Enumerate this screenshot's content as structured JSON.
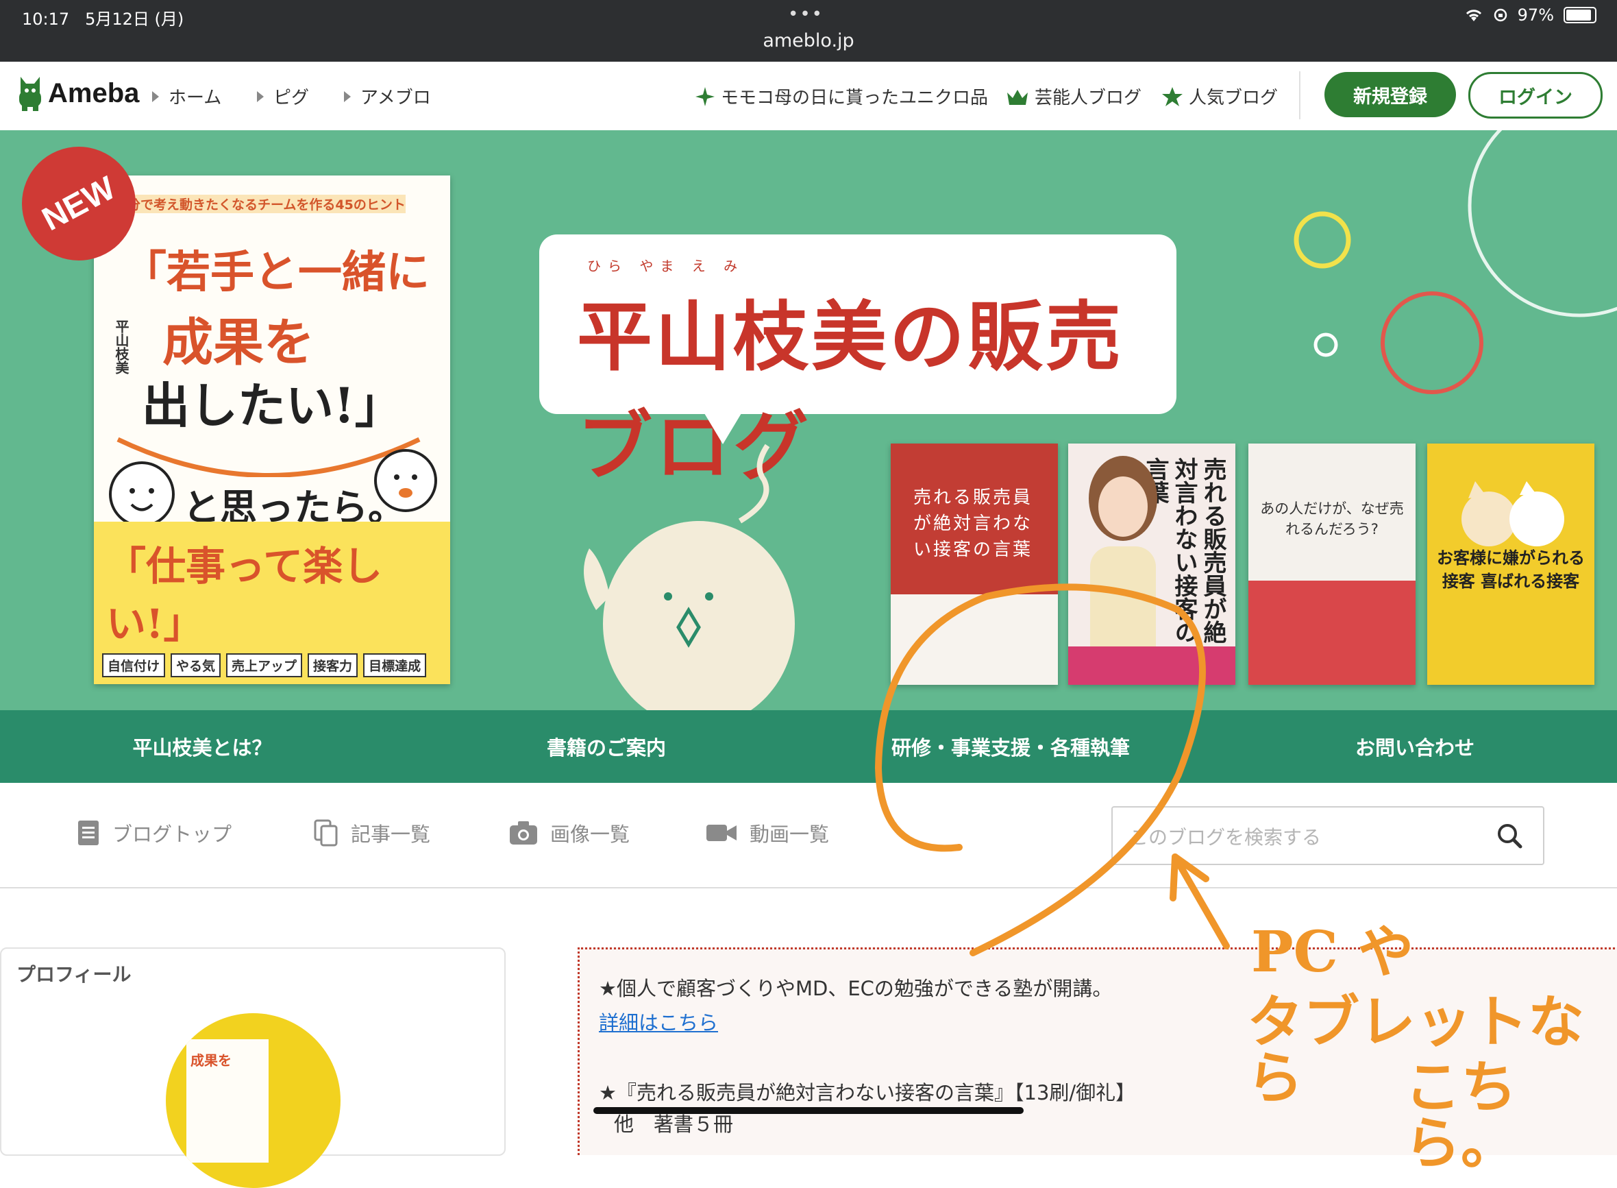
{
  "status_bar": {
    "time": "10:17",
    "date": "5月12日 (月)",
    "url": "ameblo.jp",
    "battery": "97%"
  },
  "nav": {
    "logo": "Ameba",
    "links": [
      "ホーム",
      "ピグ",
      "アメブロ"
    ],
    "right_links": [
      "モモコ母の日に貰ったユニクロ品",
      "芸能人ブログ",
      "人気ブログ"
    ],
    "register": "新規登録",
    "login": "ログイン"
  },
  "banner": {
    "badge": "NEW",
    "ruby": "ひら やま え み",
    "title": "平山枝美の販売ブログ",
    "book_main": {
      "top_line": "自分で考え動きたくなるチームを作る45のヒント",
      "title_1": "「若手と一緒に",
      "title_2": "成果を",
      "title_3": "出したい!」",
      "subtitle": "と思ったら。",
      "author": "平山枝美",
      "tagline": "「仕事って楽しい!」",
      "tags": [
        "自信付け",
        "やる気",
        "売上アップ",
        "接客力",
        "目標達成"
      ]
    },
    "books": [
      {
        "title": "売れる販売員が絶対言わない接客の言葉",
        "color": "#c23d34"
      },
      {
        "title": "売れる販売員が絶対言わない接客の言葉",
        "color": "#f0e4e8"
      },
      {
        "title": "あの人だけが、なぜ売れるんだろう?",
        "color": "#f4f1ec"
      },
      {
        "title": "お客様に嫌がられる接客 喜ばれる接客",
        "color": "#f2cc2c"
      }
    ]
  },
  "menu": [
    "平山枝美とは？",
    "書籍のご案内",
    "研修・事業支援・各種執筆",
    "お問い合わせ"
  ],
  "tabs": [
    "ブログトップ",
    "記事一覧",
    "画像一覧",
    "動画一覧"
  ],
  "search": {
    "placeholder": "このブログを検索する"
  },
  "profile": {
    "label": "プロフィール"
  },
  "notice": {
    "line1": "★個人で顧客づくりやMD、ECの勉強ができる塾が開講。",
    "link": "詳細はこちら",
    "line3": "★『売れる販売員が絶対言わない接客の言葉』【13刷/御礼】",
    "line4": "他　著書５冊"
  },
  "annotation": {
    "line1": "PC や",
    "line2": "タブレットなら",
    "line3": "こちら。",
    "color": "#f0962a"
  }
}
